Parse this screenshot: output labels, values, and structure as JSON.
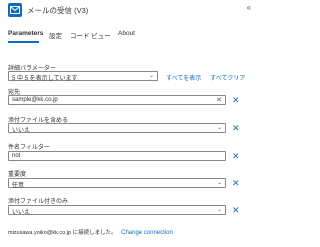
{
  "header": {
    "title": "メールの受信 (V3)",
    "collapse_icon": "double-chevron-left-icon",
    "app_icon": "mail-icon"
  },
  "tabs": [
    {
      "label": "Parameters",
      "active": true
    },
    {
      "label": "設定",
      "active": false
    },
    {
      "label": "コード ビュー",
      "active": false
    },
    {
      "label": "About",
      "active": false
    }
  ],
  "advanced": {
    "label": "詳細パラメーター",
    "value": "5 中 5 を表示しています",
    "show_all": "すべてを表示",
    "clear_all": "すべてクリア"
  },
  "fields": {
    "to": {
      "label": "宛先",
      "value": "sample@kk.co.jp"
    },
    "include_attachments": {
      "label": "添付ファイルを含める",
      "value": "いいえ"
    },
    "subject_filter": {
      "label": "件名フィルター",
      "value": "not"
    },
    "importance": {
      "label": "重要度",
      "value": "任意"
    },
    "attachments_only": {
      "label": "添付ファイル付きのみ",
      "value": "いいえ"
    }
  },
  "footer": {
    "connection_text": "mizusawa.yoiko@kk.co.jp に接続しました。",
    "change_link": "Change connection"
  },
  "colors": {
    "accent": "#0f6cbd",
    "text": "#323130",
    "border": "#8a8886"
  }
}
